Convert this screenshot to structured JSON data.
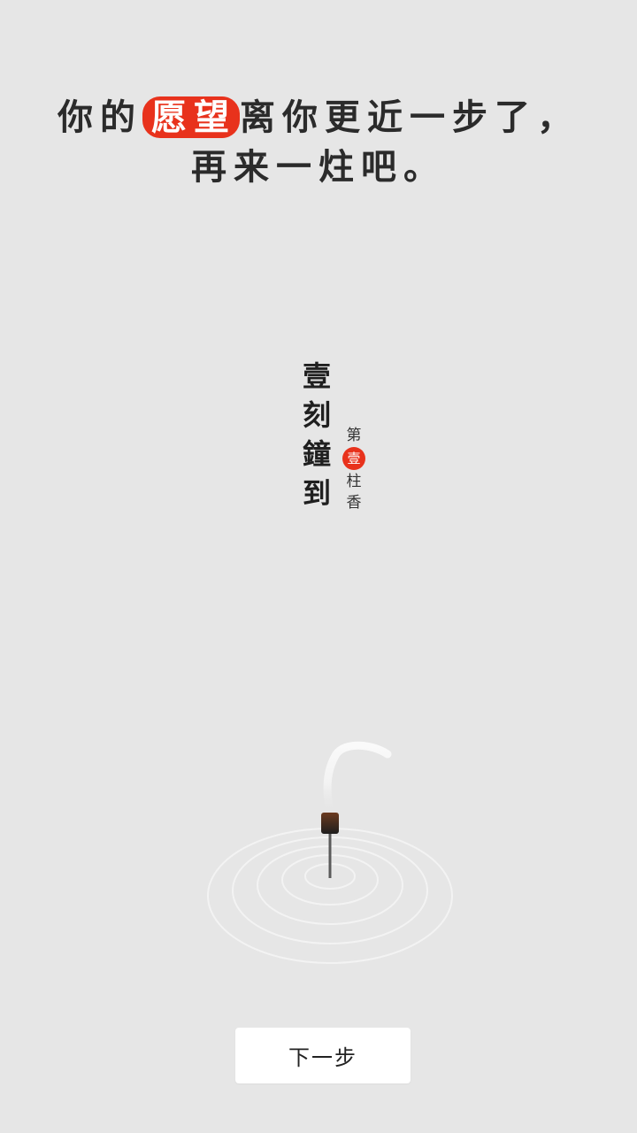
{
  "headline": {
    "line1_pre": "你的",
    "line1_highlight": "愿望",
    "line1_post": "离你更近一步了，",
    "line2": "再来一炷吧。"
  },
  "title": {
    "main": "壹刻鐘到",
    "sub_top": "第",
    "sub_badge": "壹",
    "sub_bottom_1": "柱",
    "sub_bottom_2": "香"
  },
  "colors": {
    "accent": "#e8321c",
    "background": "#e6e6e6"
  },
  "icons": {
    "incense": "incense-stick-icon"
  },
  "next_button": {
    "label": "下一步"
  }
}
